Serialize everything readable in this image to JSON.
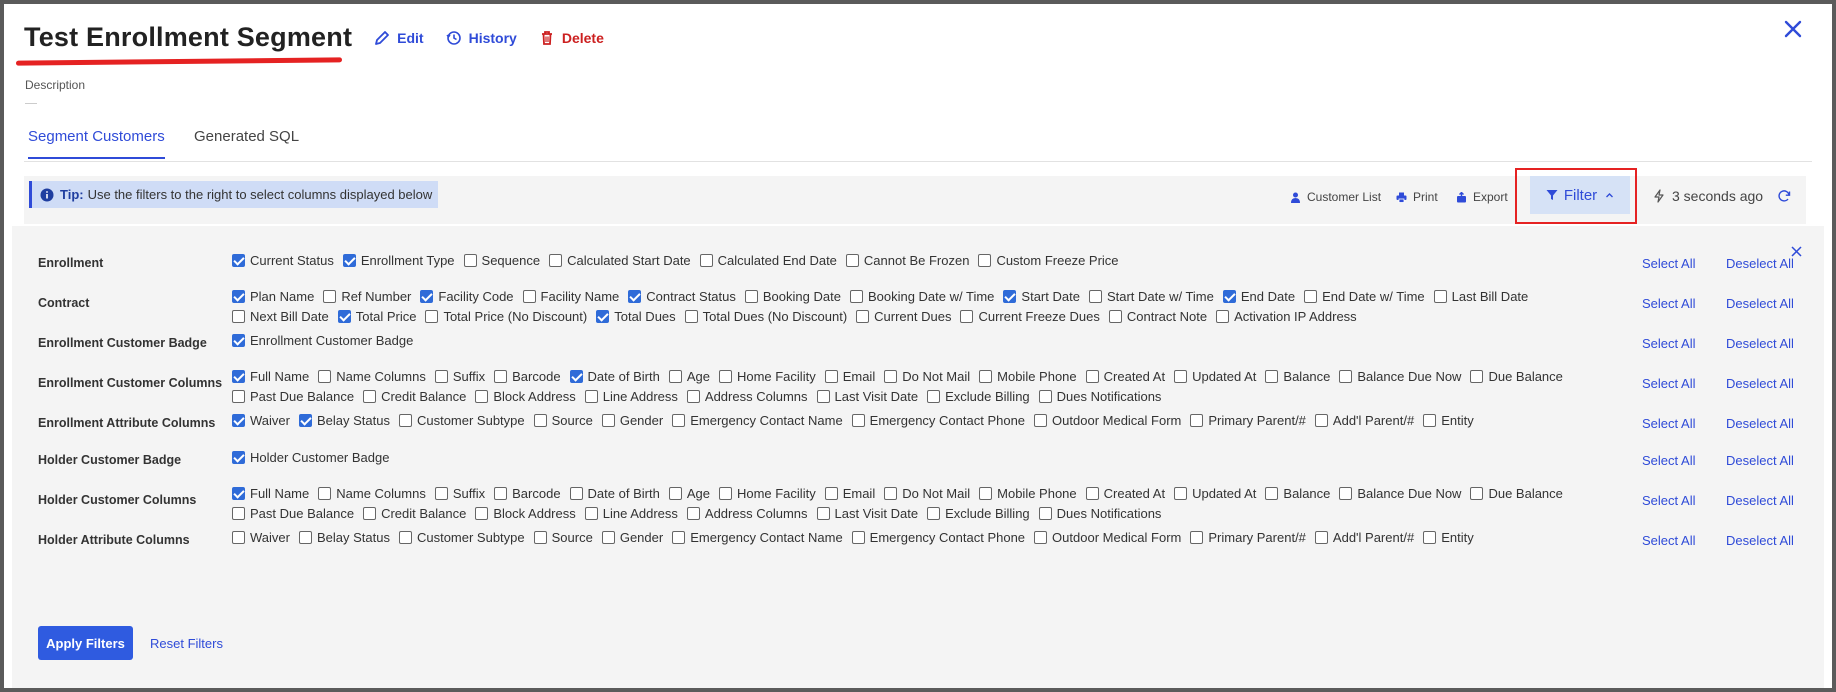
{
  "header": {
    "title": "Test Enrollment Segment",
    "edit_label": "Edit",
    "history_label": "History",
    "delete_label": "Delete",
    "description_label": "Description"
  },
  "tabs": [
    {
      "label": "Segment Customers",
      "active": true
    },
    {
      "label": "Generated SQL",
      "active": false
    }
  ],
  "toolbar": {
    "tip_bold": "Tip:",
    "tip_text": "Use the filters to the right to select columns displayed below",
    "customer_list": "Customer List",
    "print": "Print",
    "export": "Export",
    "filter": "Filter",
    "updated": "3 seconds ago"
  },
  "filters": {
    "select_all": "Select All",
    "deselect_all": "Deselect All",
    "apply": "Apply Filters",
    "reset": "Reset Filters",
    "groups": [
      {
        "label": "Enrollment",
        "options": [
          {
            "label": "Current Status",
            "checked": true
          },
          {
            "label": "Enrollment Type",
            "checked": true
          },
          {
            "label": "Sequence",
            "checked": false
          },
          {
            "label": "Calculated Start Date",
            "checked": false
          },
          {
            "label": "Calculated End Date",
            "checked": false
          },
          {
            "label": "Cannot Be Frozen",
            "checked": false
          },
          {
            "label": "Custom Freeze Price",
            "checked": false
          }
        ]
      },
      {
        "label": "Contract",
        "options": [
          {
            "label": "Plan Name",
            "checked": true
          },
          {
            "label": "Ref Number",
            "checked": false
          },
          {
            "label": "Facility Code",
            "checked": true
          },
          {
            "label": "Facility Name",
            "checked": false
          },
          {
            "label": "Contract Status",
            "checked": true
          },
          {
            "label": "Booking Date",
            "checked": false
          },
          {
            "label": "Booking Date w/ Time",
            "checked": false
          },
          {
            "label": "Start Date",
            "checked": true
          },
          {
            "label": "Start Date w/ Time",
            "checked": false
          },
          {
            "label": "End Date",
            "checked": true
          },
          {
            "label": "End Date w/ Time",
            "checked": false
          },
          {
            "label": "Last Bill Date",
            "checked": false
          },
          {
            "label": "Next Bill Date",
            "checked": false
          },
          {
            "label": "Total Price",
            "checked": true
          },
          {
            "label": "Total Price (No Discount)",
            "checked": false
          },
          {
            "label": "Total Dues",
            "checked": true
          },
          {
            "label": "Total Dues (No Discount)",
            "checked": false
          },
          {
            "label": "Current Dues",
            "checked": false
          },
          {
            "label": "Current Freeze Dues",
            "checked": false
          },
          {
            "label": "Contract Note",
            "checked": false
          },
          {
            "label": "Activation IP Address",
            "checked": false
          }
        ]
      },
      {
        "label": "Enrollment Customer Badge",
        "options": [
          {
            "label": "Enrollment Customer Badge",
            "checked": true
          }
        ]
      },
      {
        "label": "Enrollment Customer Columns",
        "options": [
          {
            "label": "Full Name",
            "checked": true
          },
          {
            "label": "Name Columns",
            "checked": false
          },
          {
            "label": "Suffix",
            "checked": false
          },
          {
            "label": "Barcode",
            "checked": false
          },
          {
            "label": "Date of Birth",
            "checked": true
          },
          {
            "label": "Age",
            "checked": false
          },
          {
            "label": "Home Facility",
            "checked": false
          },
          {
            "label": "Email",
            "checked": false
          },
          {
            "label": "Do Not Mail",
            "checked": false
          },
          {
            "label": "Mobile Phone",
            "checked": false
          },
          {
            "label": "Created At",
            "checked": false
          },
          {
            "label": "Updated At",
            "checked": false
          },
          {
            "label": "Balance",
            "checked": false
          },
          {
            "label": "Balance Due Now",
            "checked": false
          },
          {
            "label": "Due Balance",
            "checked": false
          },
          {
            "label": "Past Due Balance",
            "checked": false
          },
          {
            "label": "Credit Balance",
            "checked": false
          },
          {
            "label": "Block Address",
            "checked": false
          },
          {
            "label": "Line Address",
            "checked": false
          },
          {
            "label": "Address Columns",
            "checked": false
          },
          {
            "label": "Last Visit Date",
            "checked": false
          },
          {
            "label": "Exclude Billing",
            "checked": false
          },
          {
            "label": "Dues Notifications",
            "checked": false
          }
        ]
      },
      {
        "label": "Enrollment Attribute Columns",
        "options": [
          {
            "label": "Waiver",
            "checked": true
          },
          {
            "label": "Belay Status",
            "checked": true
          },
          {
            "label": "Customer Subtype",
            "checked": false
          },
          {
            "label": "Source",
            "checked": false
          },
          {
            "label": "Gender",
            "checked": false
          },
          {
            "label": "Emergency Contact Name",
            "checked": false
          },
          {
            "label": "Emergency Contact Phone",
            "checked": false
          },
          {
            "label": "Outdoor Medical Form",
            "checked": false
          },
          {
            "label": "Primary Parent/#",
            "checked": false
          },
          {
            "label": "Add'l Parent/#",
            "checked": false
          },
          {
            "label": "Entity",
            "checked": false
          }
        ]
      },
      {
        "label": "Holder Customer Badge",
        "options": [
          {
            "label": "Holder Customer Badge",
            "checked": true
          }
        ]
      },
      {
        "label": "Holder Customer Columns",
        "options": [
          {
            "label": "Full Name",
            "checked": true
          },
          {
            "label": "Name Columns",
            "checked": false
          },
          {
            "label": "Suffix",
            "checked": false
          },
          {
            "label": "Barcode",
            "checked": false
          },
          {
            "label": "Date of Birth",
            "checked": false
          },
          {
            "label": "Age",
            "checked": false
          },
          {
            "label": "Home Facility",
            "checked": false
          },
          {
            "label": "Email",
            "checked": false
          },
          {
            "label": "Do Not Mail",
            "checked": false
          },
          {
            "label": "Mobile Phone",
            "checked": false
          },
          {
            "label": "Created At",
            "checked": false
          },
          {
            "label": "Updated At",
            "checked": false
          },
          {
            "label": "Balance",
            "checked": false
          },
          {
            "label": "Balance Due Now",
            "checked": false
          },
          {
            "label": "Due Balance",
            "checked": false
          },
          {
            "label": "Past Due Balance",
            "checked": false
          },
          {
            "label": "Credit Balance",
            "checked": false
          },
          {
            "label": "Block Address",
            "checked": false
          },
          {
            "label": "Line Address",
            "checked": false
          },
          {
            "label": "Address Columns",
            "checked": false
          },
          {
            "label": "Last Visit Date",
            "checked": false
          },
          {
            "label": "Exclude Billing",
            "checked": false
          },
          {
            "label": "Dues Notifications",
            "checked": false
          }
        ]
      },
      {
        "label": "Holder Attribute Columns",
        "options": [
          {
            "label": "Waiver",
            "checked": false
          },
          {
            "label": "Belay Status",
            "checked": false
          },
          {
            "label": "Customer Subtype",
            "checked": false
          },
          {
            "label": "Source",
            "checked": false
          },
          {
            "label": "Gender",
            "checked": false
          },
          {
            "label": "Emergency Contact Name",
            "checked": false
          },
          {
            "label": "Emergency Contact Phone",
            "checked": false
          },
          {
            "label": "Outdoor Medical Form",
            "checked": false
          },
          {
            "label": "Primary Parent/#",
            "checked": false
          },
          {
            "label": "Add'l Parent/#",
            "checked": false
          },
          {
            "label": "Entity",
            "checked": false
          }
        ]
      }
    ]
  }
}
